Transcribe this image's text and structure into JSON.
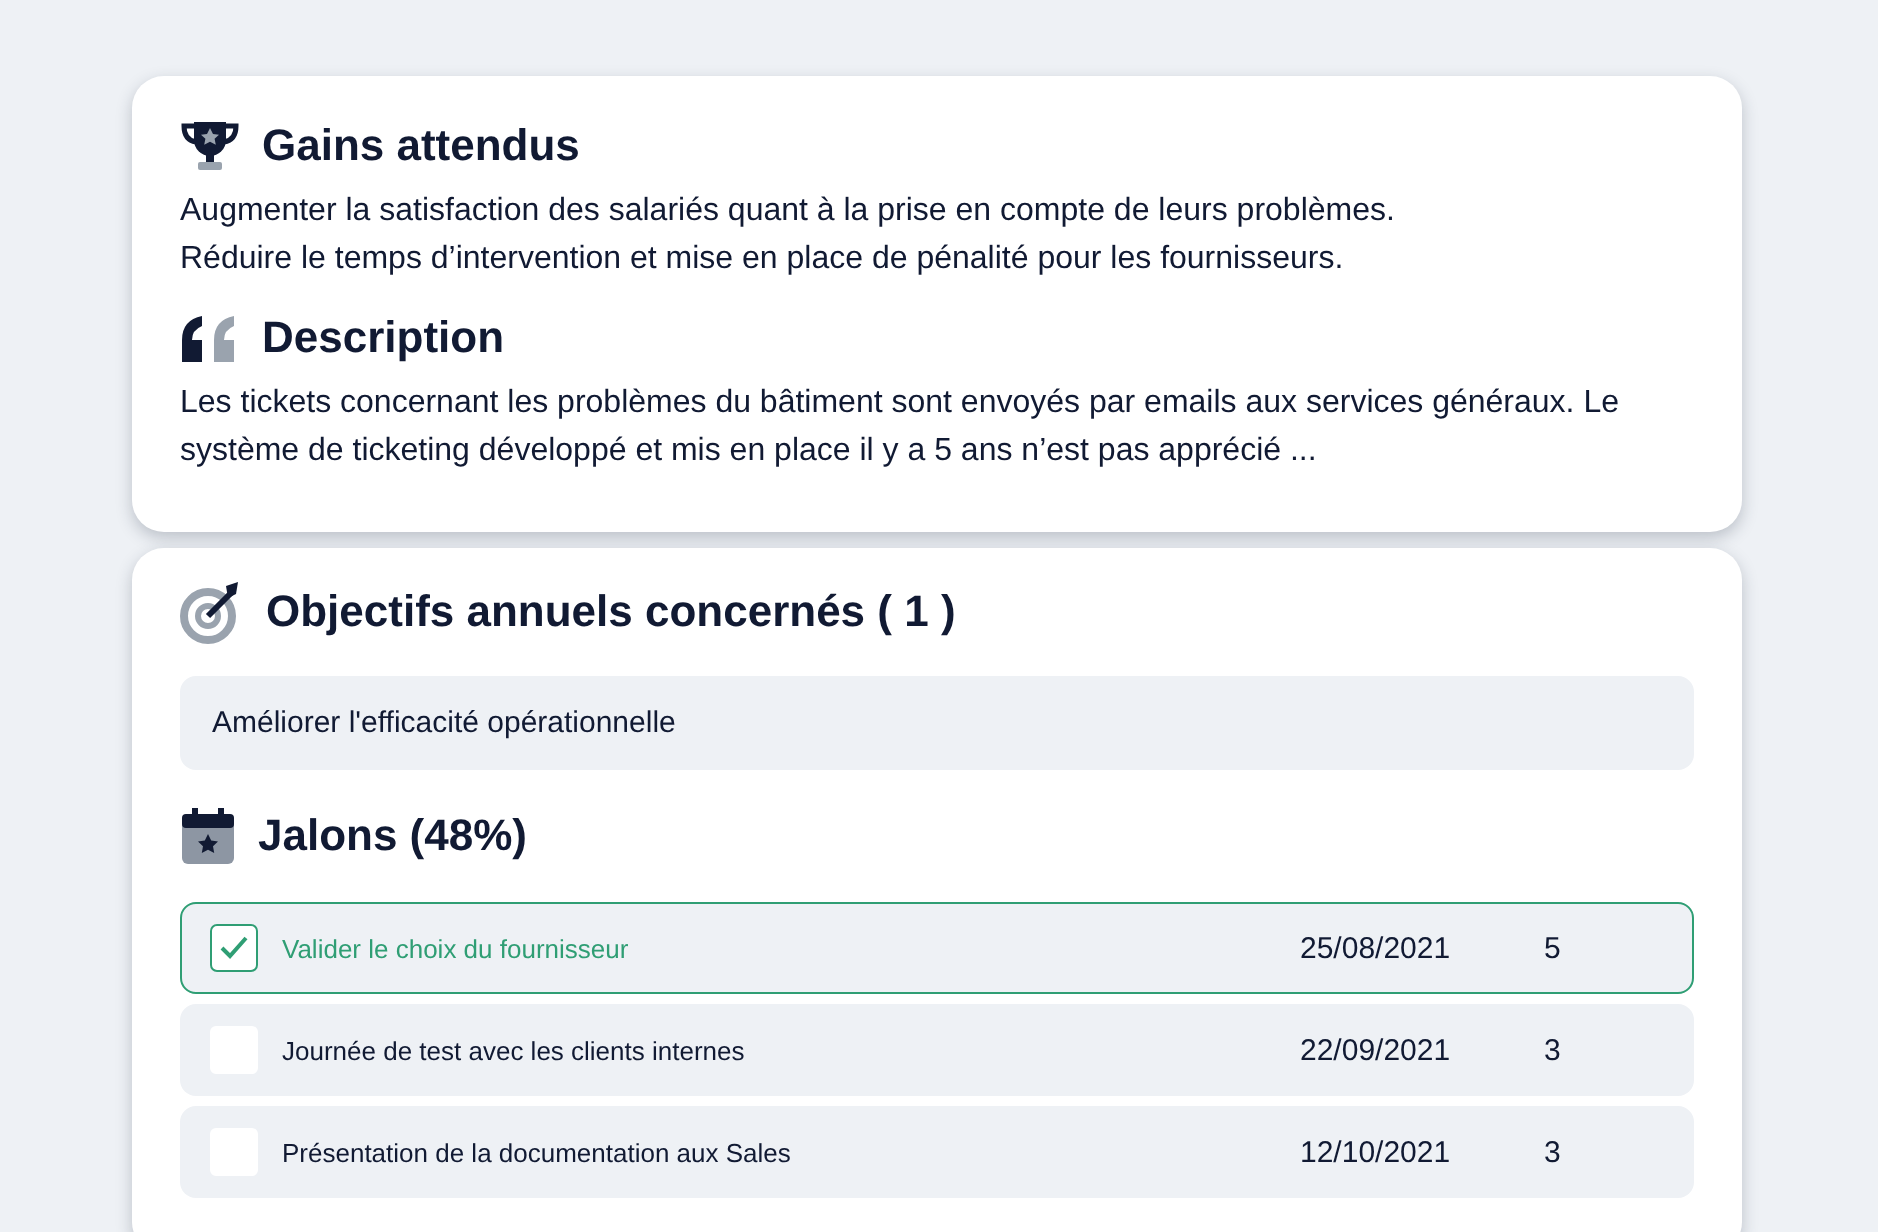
{
  "gains": {
    "title": "Gains attendus",
    "lines": [
      "Augmenter la satisfaction des salariés quant à la prise en compte de leurs problèmes.",
      "Réduire le temps d’intervention et mise en place de pénalité pour les fournisseurs."
    ]
  },
  "description": {
    "title": "Description",
    "text": "Les tickets concernant les problèmes du bâtiment sont envoyés par emails aux services généraux. Le système de ticketing développé et mis en place il y a 5 ans n’est pas apprécié ..."
  },
  "objectives": {
    "title": "Objectifs annuels concernés ( 1 )",
    "items": [
      "Améliorer l'efficacité opérationnelle"
    ]
  },
  "milestones": {
    "title": "Jalons (48%)",
    "rows": [
      {
        "label": "Valider le choix du fournisseur",
        "date": "25/08/2021",
        "weight": "5",
        "checked": true
      },
      {
        "label": "Journée de test avec les clients internes",
        "date": "22/09/2021",
        "weight": "3",
        "checked": false
      },
      {
        "label": "Présentation de la documentation aux Sales",
        "date": "12/10/2021",
        "weight": "3",
        "checked": false
      }
    ]
  }
}
